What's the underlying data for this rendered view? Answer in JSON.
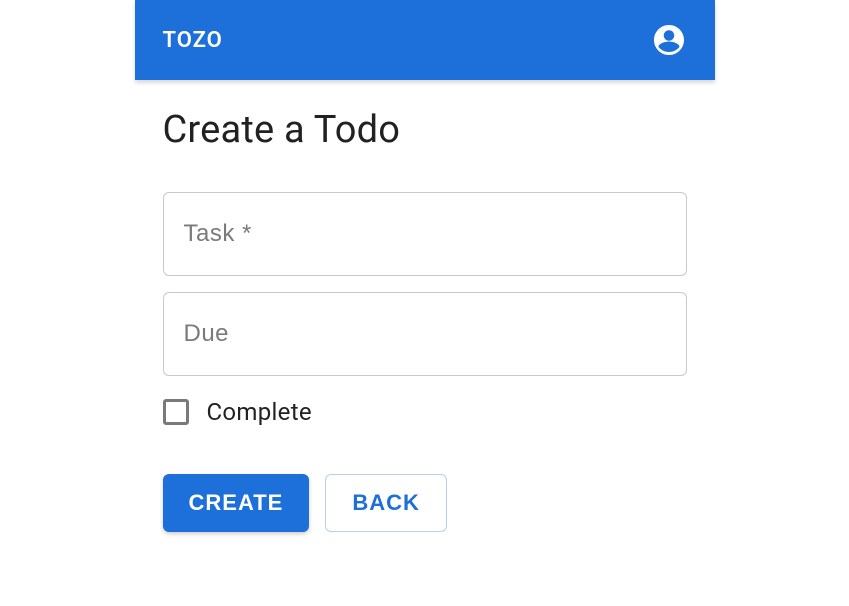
{
  "header": {
    "brand": "TOZO",
    "account_icon": "account-circle"
  },
  "page": {
    "title": "Create a Todo"
  },
  "form": {
    "task": {
      "placeholder": "Task *",
      "value": ""
    },
    "due": {
      "placeholder": "Due",
      "value": ""
    },
    "complete": {
      "label": "Complete",
      "checked": false
    }
  },
  "actions": {
    "create_label": "CREATE",
    "back_label": "BACK"
  },
  "colors": {
    "primary": "#1d6fd9",
    "text": "#212121",
    "muted": "#7a7a7a",
    "border": "#c9c9c9"
  }
}
